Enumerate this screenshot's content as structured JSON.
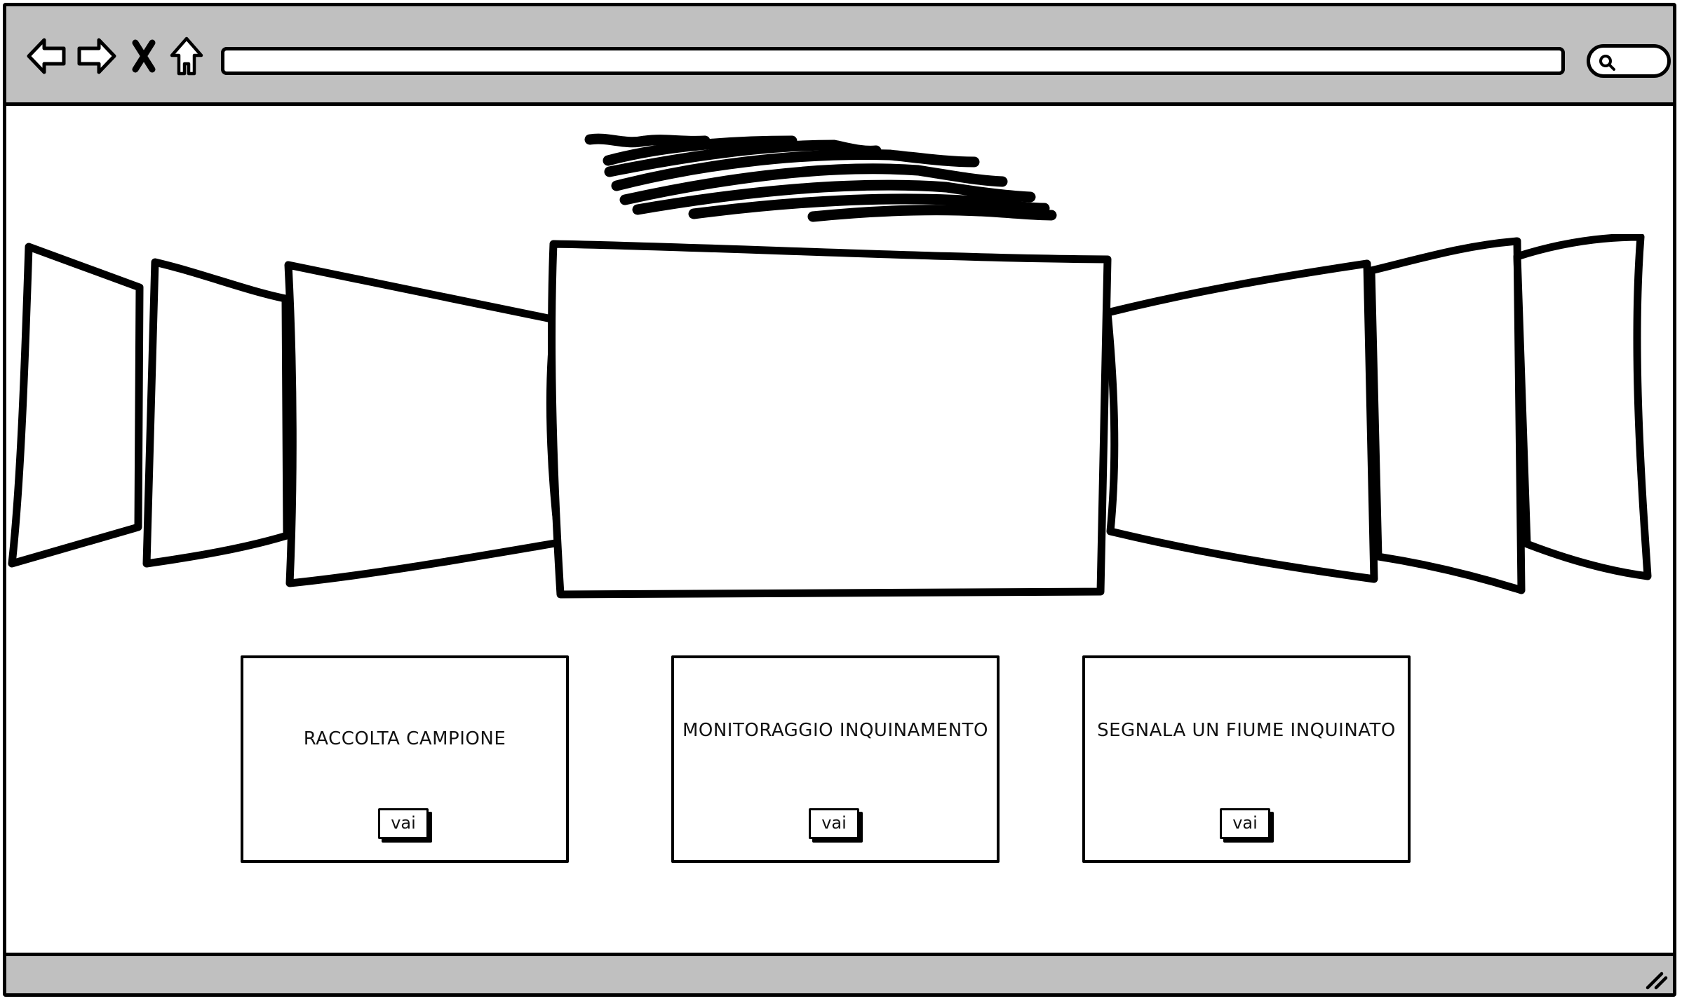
{
  "browser": {
    "icons": [
      "back-arrow-icon",
      "forward-arrow-icon",
      "close-icon",
      "home-icon",
      "search-icon",
      "resize-grip-icon"
    ],
    "url": "",
    "colors": {
      "chrome": "#c0c0c0",
      "ink": "#000000",
      "page": "#ffffff"
    }
  },
  "header": {
    "logo": "scribbled logo placeholder"
  },
  "carousel": {
    "slides": 7,
    "active": 4
  },
  "cards": [
    {
      "title": "RACCOLTA CAMPIONE",
      "button": "vai"
    },
    {
      "title": "MONITORAGGIO INQUINAMENTO",
      "button": "vai"
    },
    {
      "title": "SEGNALA UN FIUME INQUINATO",
      "button": "vai"
    }
  ]
}
